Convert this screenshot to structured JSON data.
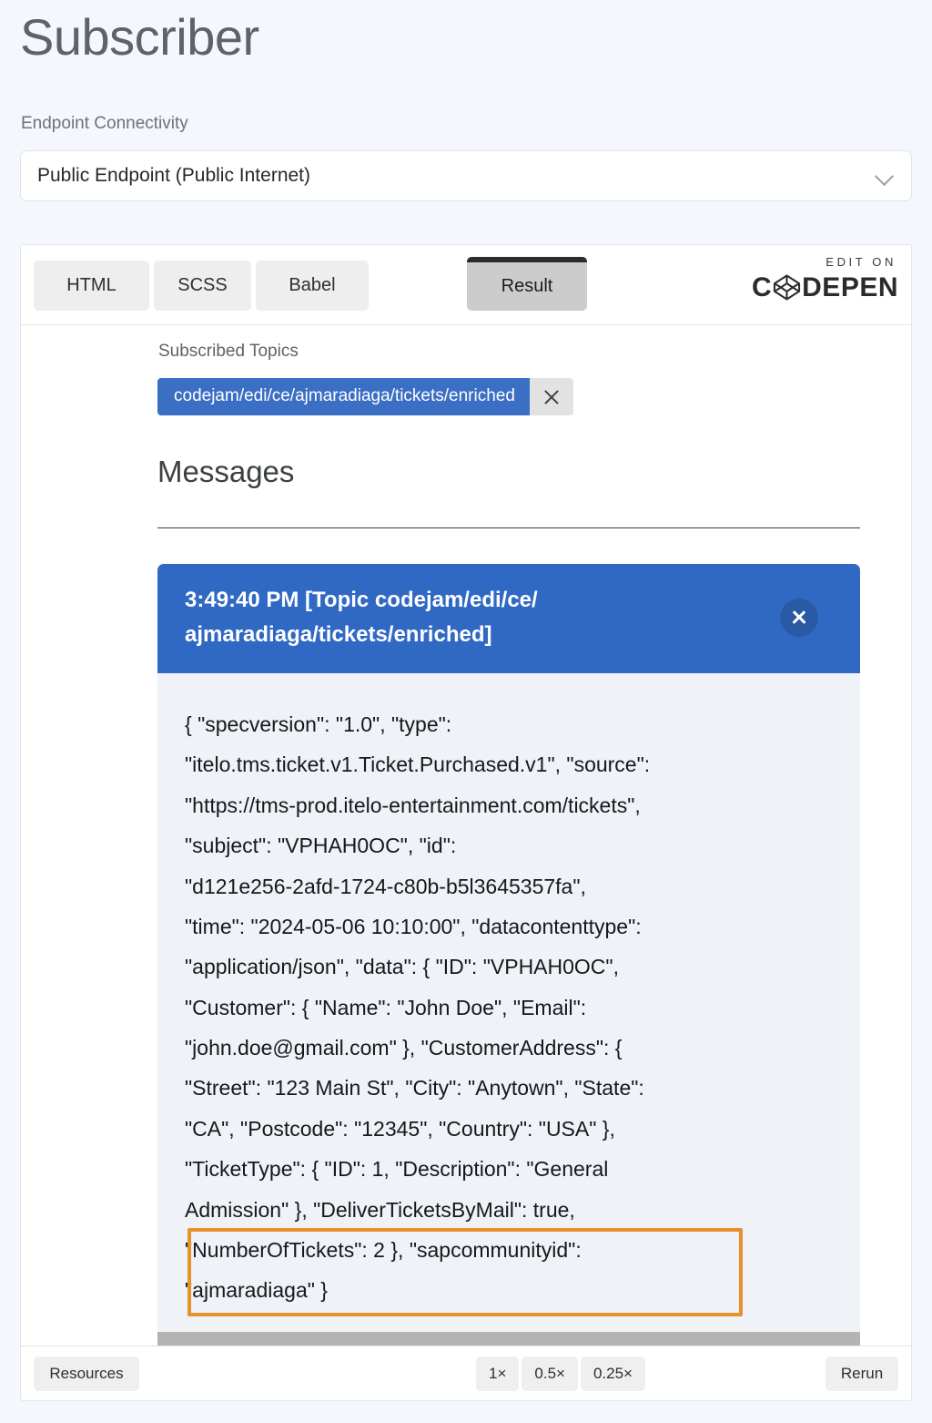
{
  "page": {
    "title": "Subscriber"
  },
  "endpoint": {
    "label": "Endpoint Connectivity",
    "selected": "Public Endpoint  (Public Internet)",
    "chevron_icon": "chevron-down-icon"
  },
  "embed": {
    "tabs": [
      {
        "id": "html",
        "label": "HTML",
        "active": false
      },
      {
        "id": "scss",
        "label": "SCSS",
        "active": false
      },
      {
        "id": "babel",
        "label": "Babel",
        "active": false
      },
      {
        "id": "result",
        "label": "Result",
        "active": true
      }
    ],
    "brand": {
      "edit_on": "EDIT ON",
      "word_left": "C",
      "word_right": "DEPEN",
      "icon": "codepen-cube-icon"
    },
    "bottom_bar": {
      "resources_label": "Resources",
      "rerun_label": "Rerun",
      "zoom_levels": [
        "1×",
        "0.5×",
        "0.25×"
      ],
      "active_zoom": "1×"
    }
  },
  "result": {
    "subscribed_topics_label": "Subscribed Topics",
    "topic_chip": {
      "text": "codejam/edi/ce/ajmaradiaga/tickets/enriched",
      "remove_icon": "close-x-icon"
    },
    "messages_heading": "Messages",
    "message": {
      "timestamp": "3:49:40 PM",
      "header": "3:49:40 PM [Topic codejam/edi/ce/\najmaradiaga/tickets/enriched]",
      "close_icon": "close-x-icon",
      "body": "{ \"specversion\": \"1.0\", \"type\":\n\"itelo.tms.ticket.v1.Ticket.Purchased.v1\", \"source\":\n\"https://tms-prod.itelo-entertainment.com/tickets\",\n\"subject\": \"VPHAH0OC\", \"id\":\n\"d121e256-2afd-1724-c80b-b5l3645357fa\",\n\"time\": \"2024-05-06 10:10:00\", \"datacontenttype\":\n\"application/json\", \"data\": { \"ID\": \"VPHAH0OC\",\n\"Customer\": { \"Name\": \"John Doe\", \"Email\":\n\"john.doe@gmail.com\" }, \"CustomerAddress\": {\n\"Street\": \"123 Main St\", \"City\": \"Anytown\", \"State\":\n\"CA\", \"Postcode\": \"12345\", \"Country\": \"USA\" },\n\"TicketType\": { \"ID\": 1, \"Description\": \"General\nAdmission\" }, \"DeliverTicketsByMail\": true,\n\"NumberOfTickets\": 2 }, \"sapcommunityid\":\n\"ajmaradiaga\" }"
    },
    "annotation": {
      "type": "rectangle-highlight",
      "color": "#e8902b",
      "covers": "\"NumberOfTickets\": 2 }, \"sapcommunityid\": \"ajmaradiaga\" }"
    }
  },
  "colors": {
    "page_bg": "#f4f7fb",
    "accent_blue": "#3069c4",
    "chip_blue": "#3b6fc4",
    "body_bg": "#eff3f8",
    "highlight_orange": "#e8902b"
  }
}
